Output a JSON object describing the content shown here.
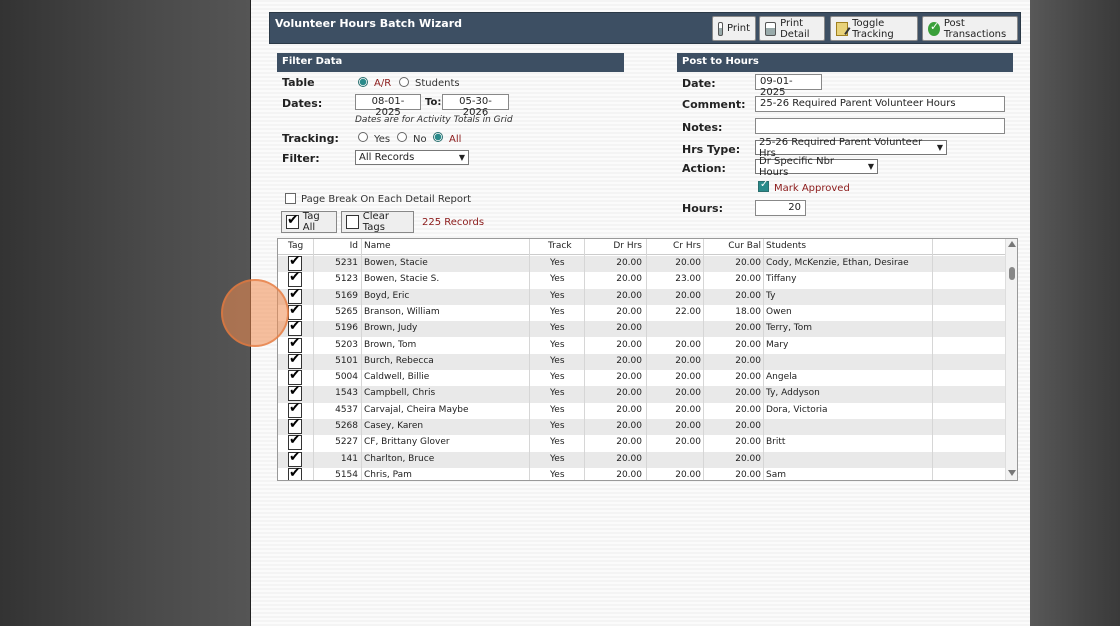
{
  "title": "Volunteer Hours Batch Wizard",
  "toolbar": {
    "print": "Print",
    "print_detail": "Print Detail",
    "toggle_tracking": "Toggle Tracking",
    "post_transactions": "Post Transactions"
  },
  "filter": {
    "header": "Filter Data",
    "table_label": "Table",
    "table_options": [
      "A/R",
      "Students"
    ],
    "table_selected": "A/R",
    "dates_label": "Dates:",
    "date_from": "08-01-2025",
    "to_label": "To:",
    "date_to": "05-30-2026",
    "dates_note": "Dates are for Activity Totals in Grid",
    "tracking_label": "Tracking:",
    "tracking_options": [
      "Yes",
      "No",
      "All"
    ],
    "tracking_selected": "All",
    "filter_label": "Filter:",
    "filter_value": "All Records",
    "page_break_label": "Page Break On Each Detail Report",
    "tag_all": "Tag All",
    "clear_tags": "Clear Tags",
    "record_count": "225 Records"
  },
  "post": {
    "header": "Post to Hours",
    "date_label": "Date:",
    "date_value": "09-01-2025",
    "comment_label": "Comment:",
    "comment_value": "25-26 Required Parent Volunteer Hours",
    "notes_label": "Notes:",
    "notes_value": "",
    "hrs_type_label": "Hrs Type:",
    "hrs_type_value": "25-26 Required Parent Volunteer Hrs",
    "action_label": "Action:",
    "action_value": "Dr Specific Nbr Hours",
    "mark_approved_label": "Mark Approved",
    "mark_approved": true,
    "hours_label": "Hours:",
    "hours_value": "20"
  },
  "grid": {
    "columns": [
      "Tag",
      "Id",
      "Name",
      "Track",
      "Dr Hrs",
      "Cr Hrs",
      "Cur Bal",
      "Students"
    ],
    "rows": [
      {
        "id": "5231",
        "name": "Bowen, Stacie",
        "track": "Yes",
        "dr": "20.00",
        "cr": "20.00",
        "bal": "20.00",
        "students": "Cody, McKenzie, Ethan, Desirae"
      },
      {
        "id": "5123",
        "name": "Bowen, Stacie S.",
        "track": "Yes",
        "dr": "20.00",
        "cr": "23.00",
        "bal": "20.00",
        "students": "Tiffany"
      },
      {
        "id": "5169",
        "name": "Boyd, Eric",
        "track": "Yes",
        "dr": "20.00",
        "cr": "20.00",
        "bal": "20.00",
        "students": "Ty"
      },
      {
        "id": "5265",
        "name": "Branson, William",
        "track": "Yes",
        "dr": "20.00",
        "cr": "22.00",
        "bal": "18.00",
        "students": "Owen"
      },
      {
        "id": "5196",
        "name": "Brown, Judy",
        "track": "Yes",
        "dr": "20.00",
        "cr": "",
        "bal": "20.00",
        "students": "Terry, Tom"
      },
      {
        "id": "5203",
        "name": "Brown, Tom",
        "track": "Yes",
        "dr": "20.00",
        "cr": "20.00",
        "bal": "20.00",
        "students": "Mary"
      },
      {
        "id": "5101",
        "name": "Burch, Rebecca",
        "track": "Yes",
        "dr": "20.00",
        "cr": "20.00",
        "bal": "20.00",
        "students": ""
      },
      {
        "id": "5004",
        "name": "Caldwell, Billie",
        "track": "Yes",
        "dr": "20.00",
        "cr": "20.00",
        "bal": "20.00",
        "students": "Angela"
      },
      {
        "id": "1543",
        "name": "Campbell, Chris",
        "track": "Yes",
        "dr": "20.00",
        "cr": "20.00",
        "bal": "20.00",
        "students": "Ty, Addyson"
      },
      {
        "id": "4537",
        "name": "Carvajal, Cheira Maybe",
        "track": "Yes",
        "dr": "20.00",
        "cr": "20.00",
        "bal": "20.00",
        "students": "Dora, Victoria"
      },
      {
        "id": "5268",
        "name": "Casey, Karen",
        "track": "Yes",
        "dr": "20.00",
        "cr": "20.00",
        "bal": "20.00",
        "students": ""
      },
      {
        "id": "5227",
        "name": "CF, Brittany Glover",
        "track": "Yes",
        "dr": "20.00",
        "cr": "20.00",
        "bal": "20.00",
        "students": "Britt"
      },
      {
        "id": "141",
        "name": "Charlton, Bruce",
        "track": "Yes",
        "dr": "20.00",
        "cr": "",
        "bal": "20.00",
        "students": ""
      },
      {
        "id": "5154",
        "name": "Chris, Pam",
        "track": "Yes",
        "dr": "20.00",
        "cr": "20.00",
        "bal": "20.00",
        "students": "Sam"
      }
    ]
  },
  "colors": {
    "header_bg": "#3d4f63",
    "accent_red": "#8b1a1a",
    "radio_teal": "#2a8a8a"
  }
}
